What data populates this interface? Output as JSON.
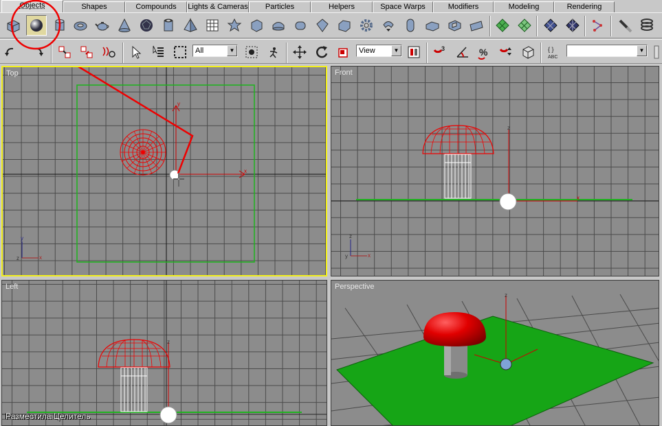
{
  "tabs": [
    {
      "label": "Objects",
      "active": true
    },
    {
      "label": "Shapes"
    },
    {
      "label": "Compounds"
    },
    {
      "label": "Lights & Cameras"
    },
    {
      "label": "Particles"
    },
    {
      "label": "Helpers"
    },
    {
      "label": "Space Warps"
    },
    {
      "label": "Modifiers"
    },
    {
      "label": "Modeling"
    },
    {
      "label": "Rendering"
    }
  ],
  "toolbar2": {
    "selection_filter": "All",
    "reference_coord": "View",
    "named_selection": ""
  },
  "viewports": {
    "top": {
      "label": "Top"
    },
    "front": {
      "label": "Front"
    },
    "left": {
      "label": "Left"
    },
    "perspective": {
      "label": "Perspective"
    }
  },
  "colors": {
    "accent_red": "#e60000",
    "active_border": "#f3f01c",
    "ground_green": "#1aa81a"
  },
  "caption": "Разместила Целитель"
}
